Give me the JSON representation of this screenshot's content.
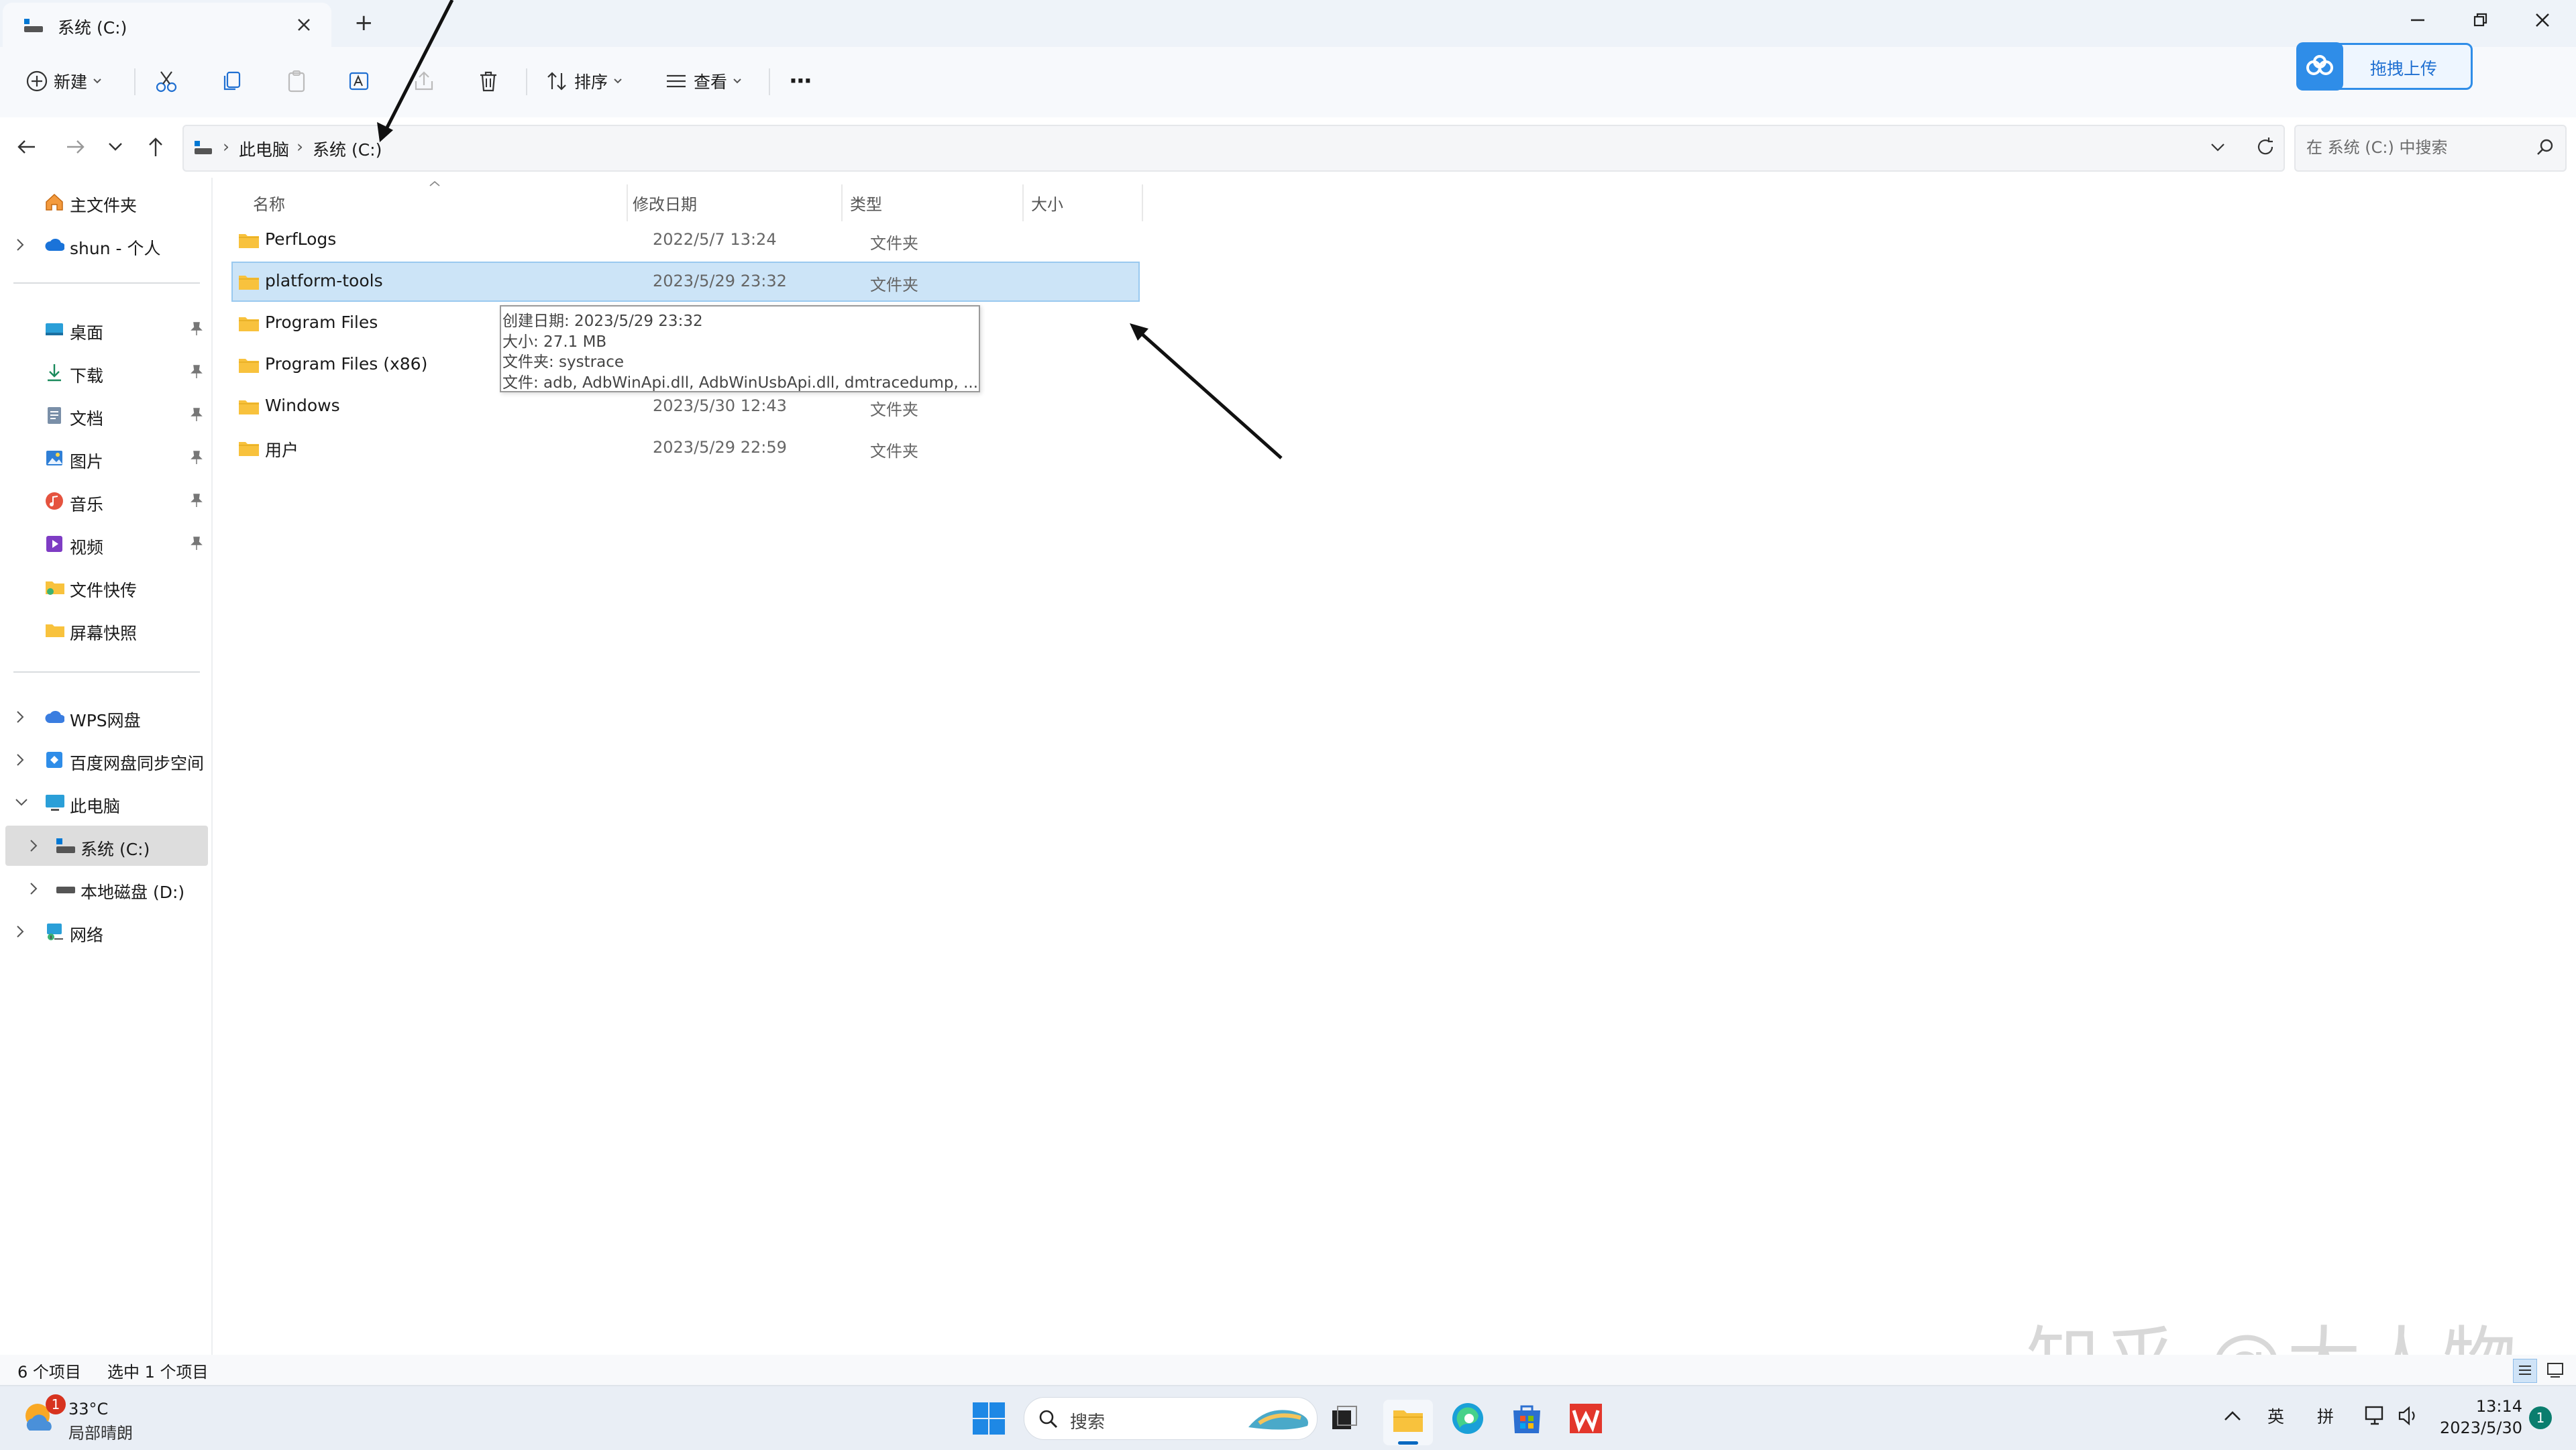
{
  "window": {
    "tab_title": "系统 (C:)",
    "new_tab_symbol": "+"
  },
  "toolbar": {
    "new_label": "新建",
    "sort_label": "排序",
    "view_label": "查看",
    "more_symbol": "···"
  },
  "upload_widget": {
    "label": "拖拽上传"
  },
  "address": {
    "crumbs": [
      "此电脑",
      "系统 (C:)"
    ],
    "search_placeholder": "在 系统 (C:) 中搜索"
  },
  "sidebar": {
    "items": [
      {
        "label": "主文件夹"
      },
      {
        "label": "shun - 个人"
      },
      {
        "label": "桌面"
      },
      {
        "label": "下载"
      },
      {
        "label": "文档"
      },
      {
        "label": "图片"
      },
      {
        "label": "音乐"
      },
      {
        "label": "视频"
      },
      {
        "label": "文件快传"
      },
      {
        "label": "屏幕快照"
      },
      {
        "label": "WPS网盘"
      },
      {
        "label": "百度网盘同步空间"
      },
      {
        "label": "此电脑"
      },
      {
        "label": "系统 (C:)"
      },
      {
        "label": "本地磁盘 (D:)"
      },
      {
        "label": "网络"
      }
    ]
  },
  "file_list": {
    "columns": [
      "名称",
      "修改日期",
      "类型",
      "大小"
    ],
    "rows": [
      {
        "name": "PerfLogs",
        "date": "2022/5/7 13:24",
        "type": "文件夹"
      },
      {
        "name": "platform-tools",
        "date": "2023/5/29 23:32",
        "type": "文件夹",
        "selected": true
      },
      {
        "name": "Program Files",
        "date": "",
        "type": ""
      },
      {
        "name": "Program Files (x86)",
        "date": "",
        "type": ""
      },
      {
        "name": "Windows",
        "date": "2023/5/30 12:43",
        "type": "文件夹"
      },
      {
        "name": "用户",
        "date": "2023/5/29 22:59",
        "type": "文件夹"
      }
    ]
  },
  "tooltip": {
    "lines": [
      "创建日期: 2023/5/29 23:32",
      "大小: 27.1 MB",
      "文件夹: systrace",
      "文件: adb, AdbWinApi.dll, AdbWinUsbApi.dll, dmtracedump, ..."
    ]
  },
  "status": {
    "item_count": "6 个项目",
    "selected_count": "选中 1 个项目"
  },
  "taskbar": {
    "weather_temp": "33°C",
    "weather_desc": "局部晴朗",
    "weather_badge": "1",
    "search_label": "搜索",
    "ime_lang": "英",
    "ime_mode": "拼",
    "clock_time": "13:14",
    "clock_date": "2023/5/30",
    "notif_count": "1"
  },
  "watermark": {
    "text": "知乎 @大人物"
  },
  "colors": {
    "selection": "#cce4f7",
    "accent": "#0067c0",
    "folder": "#f8c23d"
  }
}
